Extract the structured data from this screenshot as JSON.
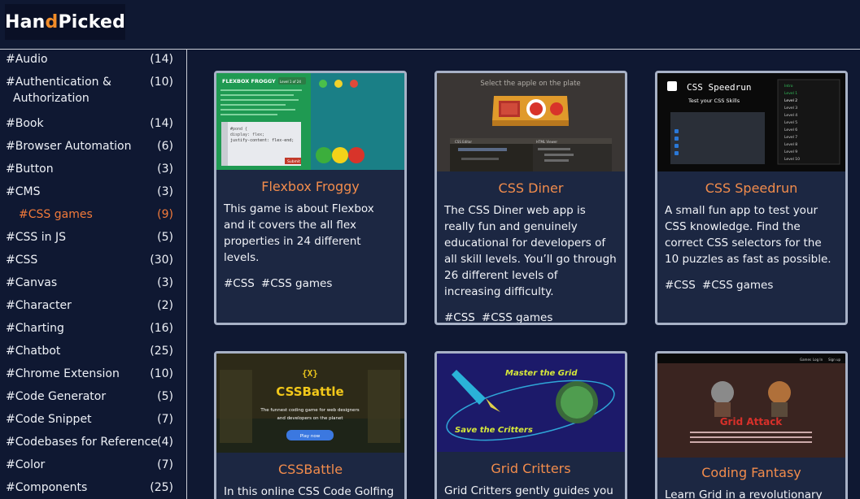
{
  "brand": {
    "name_left": "Han",
    "name_mark": "d",
    "name_right": "Picked"
  },
  "sidebar": {
    "items": [
      {
        "label": "#Audio",
        "count": "(14)"
      },
      {
        "label": "#Authentication &",
        "label2": "Authorization",
        "count": "(10)"
      },
      {
        "label": "#Book",
        "count": "(14)"
      },
      {
        "label": "#Browser Automation",
        "count": "(6)"
      },
      {
        "label": "#Button",
        "count": "(3)"
      },
      {
        "label": "#CMS",
        "count": "(3)"
      },
      {
        "label": "#CSS games",
        "count": "(9)"
      },
      {
        "label": "#CSS in JS",
        "count": "(5)"
      },
      {
        "label": "#CSS",
        "count": "(30)"
      },
      {
        "label": "#Canvas",
        "count": "(3)"
      },
      {
        "label": "#Character",
        "count": "(2)"
      },
      {
        "label": "#Charting",
        "count": "(16)"
      },
      {
        "label": "#Chatbot",
        "count": "(25)"
      },
      {
        "label": "#Chrome Extension",
        "count": "(10)"
      },
      {
        "label": "#Code Generator",
        "count": "(5)"
      },
      {
        "label": "#Code Snippet",
        "count": "(7)"
      },
      {
        "label": "#Codebases for Reference",
        "count": "(4)"
      },
      {
        "label": "#Color",
        "count": "(7)"
      },
      {
        "label": "#Components",
        "count": "(25)"
      }
    ]
  },
  "cards": [
    {
      "title": "Flexbox Froggy",
      "desc": "This game is about Flexbox and it covers the all flex properties in 24 different levels.",
      "tags": [
        "#CSS",
        "#CSS games"
      ],
      "thumb": {
        "heading": "FLEXBOX FROGGY",
        "level": "Level 1 of 24",
        "code1": "#pond {",
        "code2": "display: flex;",
        "code3": "justify-content: flex-end;",
        "submit": "Submit"
      }
    },
    {
      "title": "CSS Diner",
      "desc": "The CSS Diner web app is really fun and genuinely educational for developers of all skill levels. You’ll go through 26 different levels of increasing difficulty.",
      "tags": [
        "#CSS",
        "#CSS games"
      ],
      "thumb": {
        "caption": "Select the apple on the plate",
        "editor": "CSS Editor",
        "viewer": "HTML Viewer"
      }
    },
    {
      "title": "CSS Speedrun",
      "desc": "A small fun app to test your CSS knowledge. Find the correct CSS selectors for the 10 puzzles as fast as possible.",
      "tags": [
        "#CSS",
        "#CSS games"
      ],
      "thumb": {
        "heading": "CSS Speedrun",
        "sub": "Test your CSS Skills",
        "levels": [
          "Intro",
          "Level 1",
          "Level 2",
          "Level 3",
          "Level 4",
          "Level 5",
          "Level 6",
          "Level 7",
          "Level 8",
          "Level 9",
          "Level 10"
        ]
      }
    },
    {
      "title": "CSSBattle",
      "desc": "In this online CSS Code Golfing",
      "tags": [],
      "thumb": {
        "badge": "{X}",
        "heading": "CSSBattle",
        "sub1": "The funnest coding game for web designers",
        "sub2": "and developers on the planet",
        "button": "Play now"
      }
    },
    {
      "title": "Grid Critters",
      "desc": "Grid Critters gently guides you to",
      "tags": [],
      "thumb": {
        "text1": "Master the Grid",
        "text2": "Save the Critters"
      }
    },
    {
      "title": "Coding Fantasy",
      "desc": "Learn Grid in a revolutionary new",
      "tags": [],
      "thumb": {
        "heading": "Grid Attack",
        "nav": [
          "Games",
          "Log In",
          "Sign up"
        ]
      }
    }
  ],
  "colors": {
    "background": "#0f1832",
    "accent": "#f28c4c",
    "active": "#f27a3a",
    "card": "#1c2742",
    "border": "#a7b1c6"
  }
}
